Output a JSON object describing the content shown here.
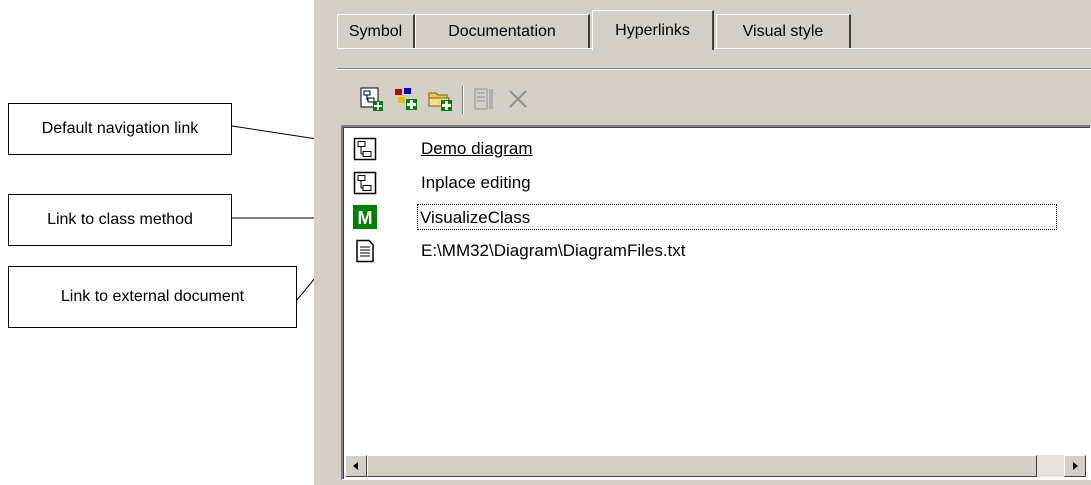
{
  "annotations": {
    "default_link": "Default navigation link",
    "class_method": "Link to class method",
    "external_doc": "Link to external document"
  },
  "tabs": [
    {
      "label": "Symbol"
    },
    {
      "label": "Documentation"
    },
    {
      "label": "Hyperlinks",
      "active": true
    },
    {
      "label": "Visual style"
    }
  ],
  "toolbar": [
    {
      "icon": "add-diagram-link-icon"
    },
    {
      "icon": "add-model-element-link-icon"
    },
    {
      "icon": "add-file-link-icon"
    },
    {
      "icon": "set-default-link-icon",
      "disabled": true
    },
    {
      "icon": "delete-link-icon",
      "disabled": true
    }
  ],
  "links": [
    {
      "icon": "diagram-icon",
      "label": "Demo diagram",
      "is_default": true
    },
    {
      "icon": "diagram-icon",
      "label": "Inplace editing"
    },
    {
      "icon": "method-icon",
      "icon_letter": "M",
      "label": "VisualizeClass",
      "focused": true
    },
    {
      "icon": "document-icon",
      "label": "E:\\MM32\\Diagram\\DiagramFiles.txt"
    }
  ],
  "colors": {
    "panel_bg": "#d4d0c8",
    "method_badge": "#008000"
  }
}
